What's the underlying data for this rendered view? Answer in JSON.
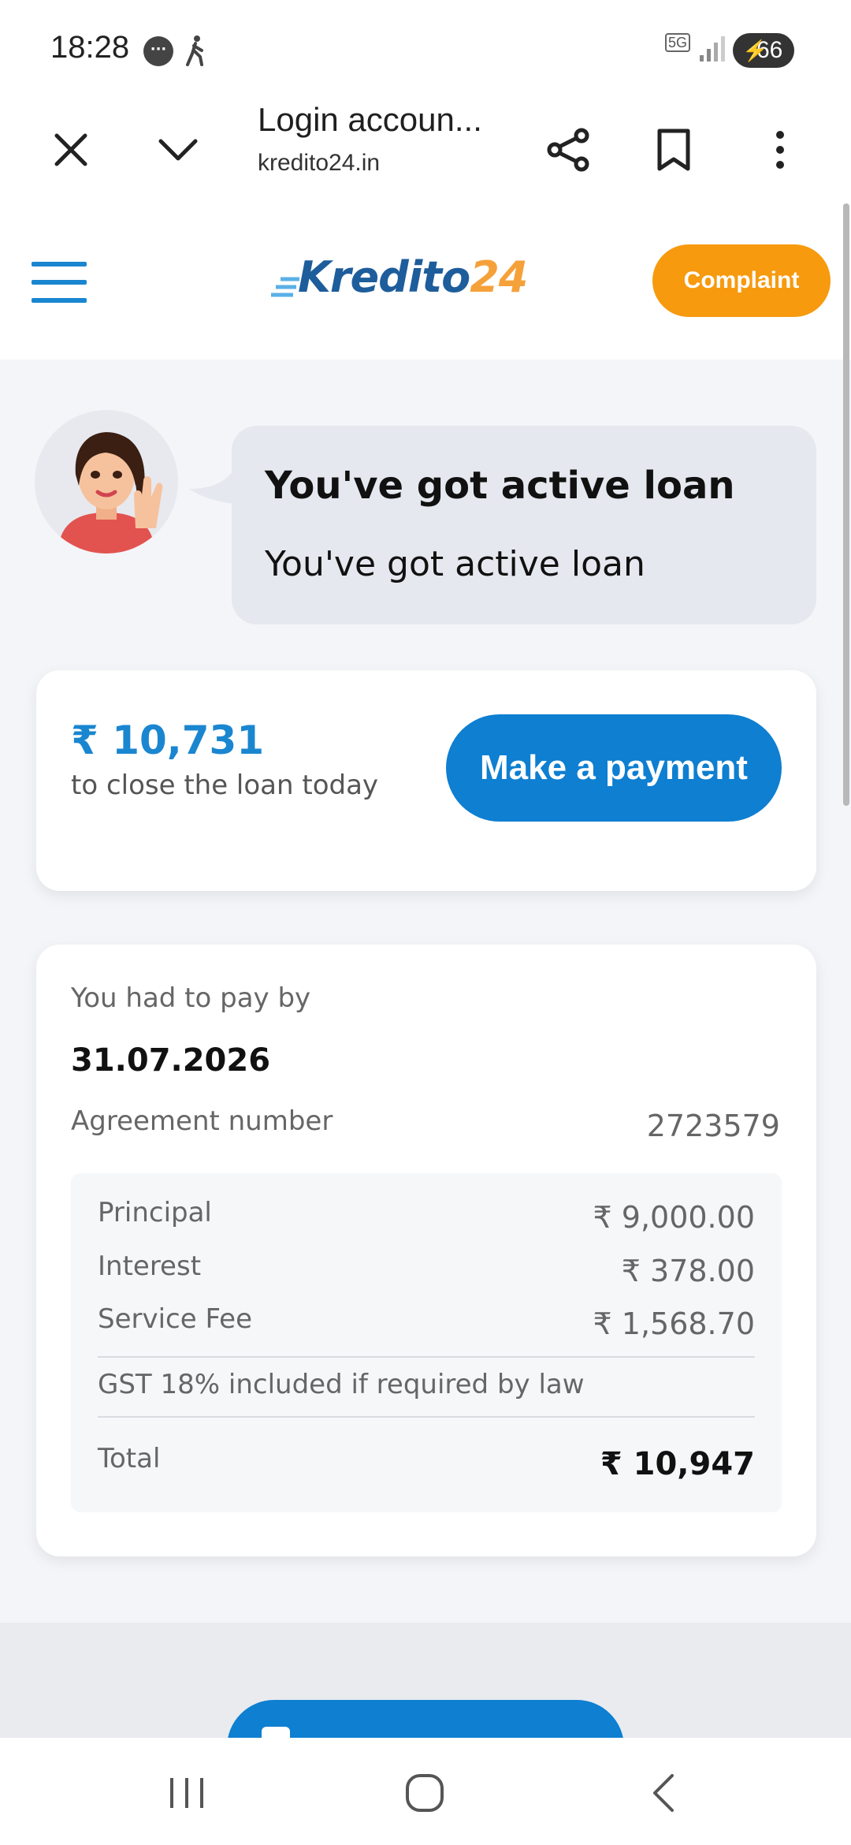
{
  "status_bar": {
    "time": "18:28",
    "network": "5G",
    "battery": "66"
  },
  "browser": {
    "page_title": "Login accoun...",
    "url": "kredito24.in"
  },
  "header": {
    "logo_part1": "Kredito",
    "logo_part2": "24",
    "complaint_label": "Complaint"
  },
  "greeting": {
    "title": "You've got active loan",
    "text": "You've got active loan"
  },
  "payment_card": {
    "amount": "₹ 10,731",
    "subtitle": "to close the loan today",
    "button_label": "Make a payment"
  },
  "loan_details": {
    "due_label": "You had to pay by",
    "due_date": "31.07.2026",
    "agreement_label": "Agreement number",
    "agreement_number": "2723579",
    "principal_label": "Principal",
    "principal_value": "₹ 9,000.00",
    "interest_label": "Interest",
    "interest_value": "₹ 378.00",
    "fee_label": "Service Fee",
    "fee_value": "₹ 1,568.70",
    "gst_note": "GST 18% included if required by law",
    "total_label": "Total",
    "total_value": "₹ 10,947"
  },
  "colors": {
    "brand_blue": "#0e7fd1",
    "brand_orange": "#f79a0e",
    "logo_blue": "#1d5d9b",
    "logo_orange": "#f5a13a"
  },
  "icons": [
    "close-icon",
    "chevron-down-icon",
    "share-icon",
    "bookmark-icon",
    "more-vert-icon",
    "hamburger-icon",
    "recents-icon",
    "home-icon",
    "back-icon"
  ]
}
